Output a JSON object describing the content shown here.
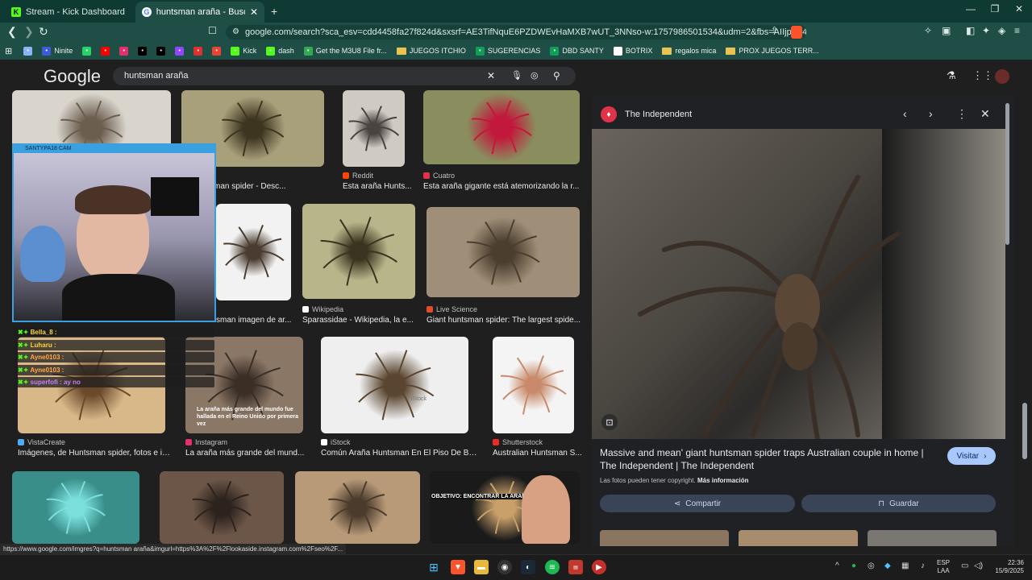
{
  "browser": {
    "tabs": [
      {
        "label": "Stream - Kick Dashboard",
        "favicon_color": "#53fc18"
      },
      {
        "label": "huntsman araña - Buscar con Go",
        "favicon_color": "#ffffff"
      }
    ],
    "new_tab": "+",
    "window_controls": {
      "minimize": "—",
      "restore": "❐",
      "close": "✕"
    },
    "url": "google.com/search?sca_esv=cdd4458fa27f824d&sxsrf=AE3TifNquE6PZDWEvHaMXB7wUT_3NNso-w:1757986501534&udm=2&fbs=AIIjpHx4nJjfGojPVHhE...",
    "bookmarks": [
      {
        "label": "",
        "icon": "settings-icon",
        "color": "#8ab4f8"
      },
      {
        "label": "Ninite",
        "icon": "ninite-icon",
        "color": "#3b5bdb"
      },
      {
        "label": "",
        "icon": "whatsapp-icon",
        "color": "#25d366"
      },
      {
        "label": "",
        "icon": "youtube-icon",
        "color": "#ff0000"
      },
      {
        "label": "",
        "icon": "instagram-icon",
        "color": "#e1306c"
      },
      {
        "label": "",
        "icon": "tiktok-icon",
        "color": "#000000"
      },
      {
        "label": "",
        "icon": "x-icon",
        "color": "#000000"
      },
      {
        "label": "",
        "icon": "twitch-icon",
        "color": "#9146ff"
      },
      {
        "label": "",
        "icon": "bolt-icon",
        "color": "#e03131"
      },
      {
        "label": "",
        "icon": "gmail-icon",
        "color": "#ea4335"
      },
      {
        "label": "Kick",
        "icon": "kick-icon",
        "color": "#53fc18"
      },
      {
        "label": "dash",
        "icon": "kick-icon",
        "color": "#53fc18"
      },
      {
        "label": "Get the M3U8 File fr...",
        "icon": "globe-icon",
        "color": "#34a853"
      },
      {
        "label": "JUEGOS ITCHIO",
        "icon": "folder-icon",
        "color": "#e8c252"
      },
      {
        "label": "SUGERENCIAS",
        "icon": "sheets-icon",
        "color": "#0f9d58"
      },
      {
        "label": "DBD SANTY",
        "icon": "sheets-icon",
        "color": "#0f9d58"
      },
      {
        "label": "BOTRIX",
        "icon": "diamond-icon",
        "color": "#ffffff"
      },
      {
        "label": "regalos mica",
        "icon": "folder-icon",
        "color": "#e8c252"
      },
      {
        "label": "PROX JUEGOS TERR...",
        "icon": "folder-icon",
        "color": "#e8c252"
      }
    ]
  },
  "google": {
    "logo": "Google",
    "query": "huntsman araña"
  },
  "results": [
    {
      "source": "",
      "caption": "",
      "color": "#d9d4cc",
      "shade": "#6b5e4f"
    },
    {
      "source": "",
      "caption": "de Huntsman spider - Desc...",
      "color": "#a8a07a",
      "shade": "#3d3520"
    },
    {
      "source": "Reddit",
      "caption": "Esta araña Hunts...",
      "color": "#cfcac2",
      "shade": "#4a4440",
      "srccolor": "#ff4500"
    },
    {
      "source": "Cuatro",
      "caption": "Esta araña gigante está atemorizando la r...",
      "color": "#8a8d5e",
      "shade": "#c2183b",
      "srccolor": "#e0334a"
    },
    {
      "source": "",
      "caption": "sman imagen de ar...",
      "color": "#f2f2f2",
      "shade": "#4a3c30"
    },
    {
      "source": "Wikipedia",
      "caption": "Sparassidae - Wikipedia, la e...",
      "color": "#b8b58a",
      "shade": "#3b3421",
      "srccolor": "#ffffff"
    },
    {
      "source": "Live Science",
      "caption": "Giant huntsman spider: The largest spide...",
      "color": "#a08f78",
      "shade": "#4b3e2f",
      "srccolor": "#e34c26"
    },
    {
      "source": "VistaCreate",
      "caption": "Imágenes, de Huntsman spider, fotos e imá...",
      "color": "#d8b888",
      "shade": "#6b4a2c",
      "srccolor": "#4dabf7"
    },
    {
      "source": "Instagram",
      "caption": "La araña más grande del mund...",
      "color": "#8b7766",
      "shade": "#3a2e26",
      "srccolor": "#e1306c"
    },
    {
      "source": "iStock",
      "caption": "Común Araña Huntsman En El Piso De Bal...",
      "color": "#efefef",
      "shade": "#5a4630",
      "srccolor": "#ffffff"
    },
    {
      "source": "Shutterstock",
      "caption": "Australian Huntsman S...",
      "color": "#f4f4f4",
      "shade": "#c88a6a",
      "srccolor": "#ee2b24"
    },
    {
      "source": "",
      "caption": "",
      "color": "#3a8e8a",
      "shade": "#7be0dc"
    },
    {
      "source": "",
      "caption": "",
      "color": "#6c5648",
      "shade": "#2d231d"
    },
    {
      "source": "",
      "caption": "",
      "color": "#b89a78",
      "shade": "#4b3b2c"
    },
    {
      "source": "",
      "caption": "",
      "color": "#1a1a1a",
      "shade": "#c9a06a"
    }
  ],
  "overlay_text": {
    "instagram_caption": "La araña más grande del mundo fue hallada en el Reino Unido por primera vez",
    "istock_watermark": "iStock",
    "video_title": "OBJETIVO: ENCONTRAR LA ARAÑA"
  },
  "panel": {
    "source": "The Independent",
    "title": "Massive and mean' giant huntsman spider traps Australian couple in home | The Independent | The Independent",
    "copyright": "Las fotos pueden tener copyright.",
    "more_info": "Más información",
    "visit": "Visitar",
    "share": "Compartir",
    "save": "Guardar"
  },
  "stream_overlay": {
    "cam_label": "SANTYPA18 CAM",
    "chat": [
      {
        "user": "Bella_8 :",
        "color": "#ffd43b"
      },
      {
        "user": "Luharu :",
        "color": "#ffd43b"
      },
      {
        "user": "Ayne0103 :",
        "color": "#ffa94d"
      },
      {
        "user": "Ayne0103 :",
        "color": "#ffa94d"
      },
      {
        "user": "superfofi : ay no",
        "color": "#c77dff"
      }
    ]
  },
  "status_url": "https://www.google.com/imgres?q=huntsman araña&imgurl=https%3A%2F%2Flookaside.instagram.com%2Fseo%2F...",
  "taskbar": {
    "language": "ESP",
    "layout": "LAA",
    "time": "22:36",
    "date": "15/9/2025"
  }
}
